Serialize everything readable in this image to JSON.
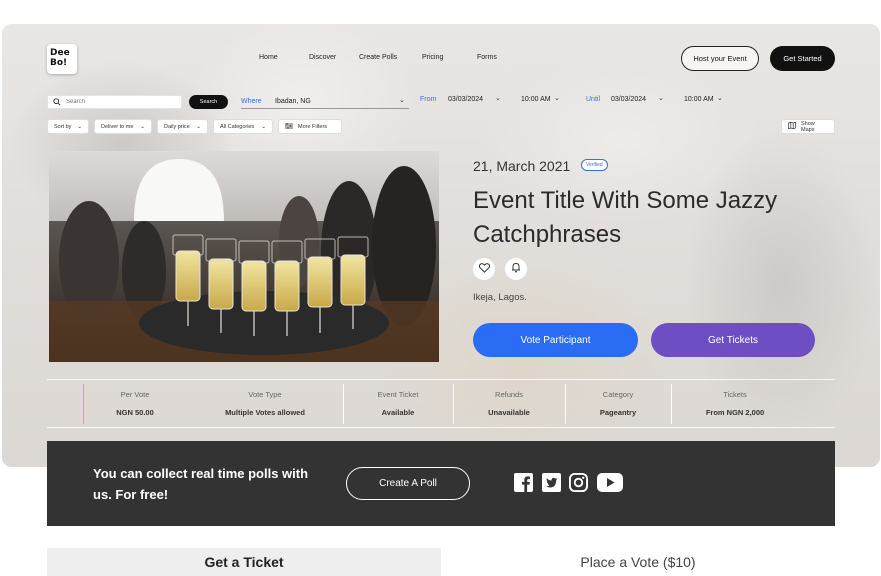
{
  "logo": {
    "line1": "Dee",
    "line2": "Bo!"
  },
  "nav": {
    "links": [
      "Home",
      "Discover",
      "Create Polls",
      "Pricing",
      "Forms"
    ],
    "host_label": "Host your Event",
    "get_started_label": "Get Started"
  },
  "search": {
    "placeholder": "Search",
    "button_label": "Search",
    "where_label": "Where",
    "where_value": "Ibadan, NG",
    "from_label": "From",
    "from_date": "03/03/2024",
    "from_time": "10:00 AM",
    "until_label": "Until",
    "until_date": "03/03/2024",
    "until_time": "10:00 AM"
  },
  "filters": {
    "items": [
      "Sort by",
      "Deliver to me",
      "Daily price",
      "All Categories"
    ],
    "more_filters_label": "More Filters",
    "show_maps_label": "Show Maps"
  },
  "event": {
    "date": "21, March 2021",
    "verified_label": "Verified",
    "title": "Event Title With Some Jazzy Catchphrases",
    "location": "Ikeja, Lagos.",
    "vote_button_label": "Vote Participant",
    "tickets_button_label": "Get Tickets"
  },
  "stats": [
    {
      "label": "Per Vote",
      "value": "NGN 50.00"
    },
    {
      "label": "Vote Type",
      "value": "Multiple Votes allowed"
    },
    {
      "label": "Event Ticket",
      "value": "Available"
    },
    {
      "label": "Refunds",
      "value": "Unavailable"
    },
    {
      "label": "Category",
      "value": "Pageantry"
    },
    {
      "label": "Tickets",
      "value": "From NGN 2,000"
    }
  ],
  "promo": {
    "text": "You can collect real time polls with us. For free!",
    "button_label": "Create A Poll",
    "social_icons": [
      "facebook-icon",
      "twitter-icon",
      "instagram-icon",
      "youtube-icon"
    ]
  },
  "tabs": {
    "ticket_label": "Get a Ticket",
    "vote_label": "Place a Vote ($10)"
  },
  "colors": {
    "primary_blue": "#2a6df4",
    "primary_purple": "#6d4ec3",
    "dark": "#111111",
    "banner": "#333333"
  }
}
